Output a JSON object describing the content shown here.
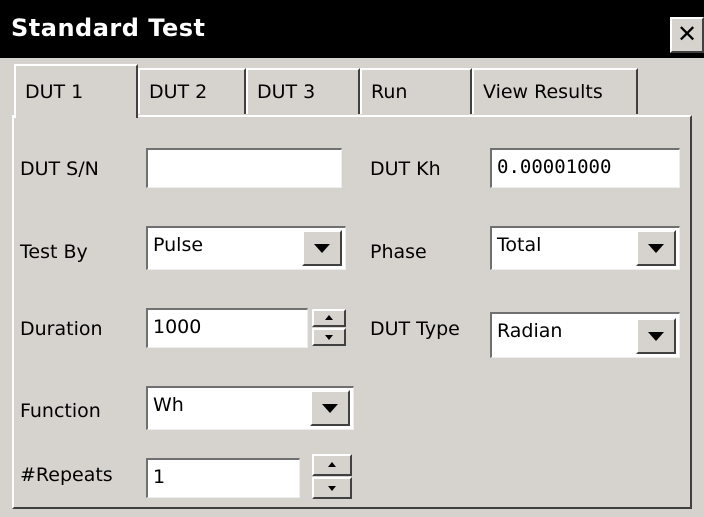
{
  "window": {
    "title": "Standard Test",
    "close_label": "✕"
  },
  "tabs": [
    {
      "label": "DUT 1",
      "active": true
    },
    {
      "label": "DUT 2",
      "active": false
    },
    {
      "label": "DUT 3",
      "active": false
    },
    {
      "label": "Run",
      "active": false
    },
    {
      "label": "View Results",
      "active": false
    }
  ],
  "form": {
    "dut_sn": {
      "label": "DUT S/N",
      "value": ""
    },
    "dut_kh": {
      "label": "DUT  Kh",
      "value": "0.00001000"
    },
    "test_by": {
      "label": "Test By",
      "value": "Pulse"
    },
    "phase": {
      "label": "Phase",
      "value": "Total"
    },
    "duration": {
      "label": "Duration",
      "value": "1000"
    },
    "dut_type": {
      "label": "DUT Type",
      "value": "Radian"
    },
    "function": {
      "label": "Function",
      "value": "Wh"
    },
    "repeats": {
      "label": "#Repeats",
      "value": "1"
    }
  },
  "icons": {
    "close": "close-icon",
    "dropdown": "chevron-down-icon",
    "spin_up": "spin-up-icon",
    "spin_down": "spin-down-icon"
  },
  "colors": {
    "titlebar": "#000000",
    "face": "#d6d3ce",
    "field": "#ffffff"
  }
}
